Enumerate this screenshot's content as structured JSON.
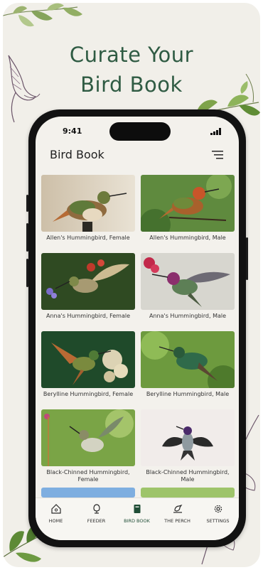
{
  "headline": {
    "line1": "Curate Your",
    "line2": "Bird Book"
  },
  "status_bar": {
    "time": "9:41"
  },
  "header": {
    "title": "Bird Book",
    "menu_icon": "menu-icon"
  },
  "birds": [
    {
      "caption": "Allen's Hummingbird, Female"
    },
    {
      "caption": "Allen's Hummingbird, Male"
    },
    {
      "caption": "Anna's Hummingbird, Female"
    },
    {
      "caption": "Anna's Hummingbird, Male"
    },
    {
      "caption": "Berylline Hummingbird, Female"
    },
    {
      "caption": "Berylline Hummingbird, Male"
    },
    {
      "caption": "Black-Chinned Hummingbird, Female"
    },
    {
      "caption": "Black-Chinned Hummingbird, Male"
    }
  ],
  "tabs": [
    {
      "label": "HOME",
      "icon": "home-icon"
    },
    {
      "label": "FEEDER",
      "icon": "feeder-icon"
    },
    {
      "label": "BIRD BOOK",
      "icon": "book-icon",
      "active": true
    },
    {
      "label": "THE PERCH",
      "icon": "perch-icon"
    },
    {
      "label": "SETTINGS",
      "icon": "gear-icon"
    }
  ],
  "colors": {
    "accent": "#2f5b43",
    "background": "#f1efe9",
    "leaf": "#6e9a3e"
  }
}
